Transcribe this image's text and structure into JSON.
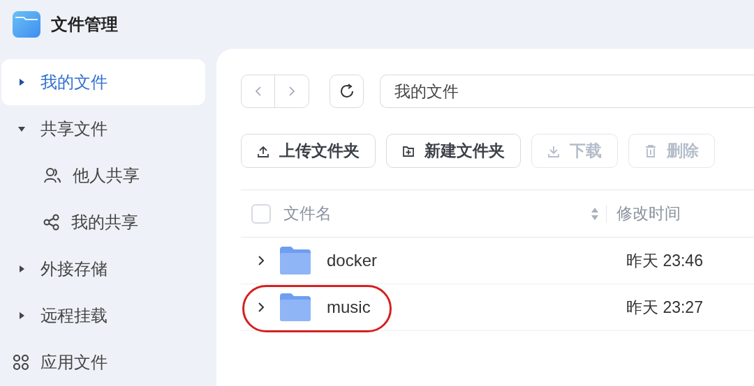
{
  "app": {
    "title": "文件管理"
  },
  "sidebar": {
    "items": [
      {
        "label": "我的文件",
        "kind": "expandable",
        "selected": true,
        "expanded": false
      },
      {
        "label": "共享文件",
        "kind": "expandable",
        "selected": false,
        "expanded": true,
        "children": [
          {
            "label": "他人共享",
            "kind": "users",
            "selected": false
          },
          {
            "label": "我的共享",
            "kind": "share",
            "selected": false
          }
        ]
      },
      {
        "label": "外接存储",
        "kind": "expandable",
        "selected": false,
        "expanded": false
      },
      {
        "label": "远程挂载",
        "kind": "expandable",
        "selected": false,
        "expanded": false
      },
      {
        "label": "应用文件",
        "kind": "apps",
        "selected": false
      }
    ]
  },
  "path_field": {
    "value": "我的文件"
  },
  "toolbar": [
    {
      "label": "上传文件夹",
      "kind": "upload",
      "disabled": false
    },
    {
      "label": "新建文件夹",
      "kind": "new-folder",
      "disabled": false
    },
    {
      "label": "下载",
      "kind": "download",
      "disabled": true
    },
    {
      "label": "删除",
      "kind": "delete",
      "disabled": true
    }
  ],
  "table": {
    "select_all": {
      "checked": false
    },
    "columns": [
      "文件名",
      "修改时间"
    ],
    "rows": [
      {
        "name": "docker",
        "modified": "昨天 23:46",
        "circled": false
      },
      {
        "name": "music",
        "modified": "昨天 23:27",
        "circled": true
      }
    ]
  }
}
